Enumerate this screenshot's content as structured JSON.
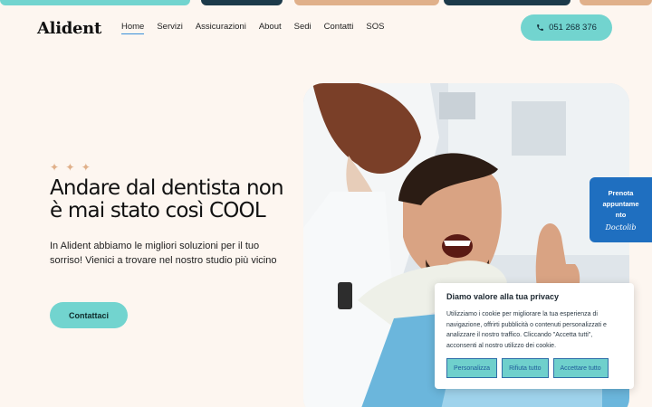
{
  "colors": {
    "accent": "#72d4cf",
    "booking": "#1f6fc0",
    "background": "#fdf6f0"
  },
  "header": {
    "logo": "Alident",
    "nav": [
      "Home",
      "Servizi",
      "Assicurazioni",
      "About",
      "Sedi",
      "Contatti",
      "SOS"
    ],
    "active_nav": "Home",
    "phone": "051 268 376",
    "phone_icon": "phone-icon"
  },
  "hero": {
    "sparkles": "✦ ✦ ✦",
    "title": "Andare dal dentista non è mai stato così COOL",
    "subtitle": "In Alident abbiamo le migliori soluzioni per il tuo sorriso! Vienici a trovare nel nostro studio più vicino",
    "cta": "Contattaci"
  },
  "booking": {
    "line1": "Prenota",
    "line2": "appuntame",
    "line3": "nto",
    "brand": "Doctolib"
  },
  "cookie": {
    "title": "Diamo valore alla tua privacy",
    "text": "Utilizziamo i cookie per migliorare la tua esperienza di navigazione, offrirti pubblicità o contenuti personalizzati e analizzare il nostro traffico. Cliccando \"Accetta tutti\", acconsenti al nostro utilizzo dei cookie.",
    "buttons": [
      "Personalizza",
      "Rifiuta tutto",
      "Accettare tutto"
    ]
  }
}
